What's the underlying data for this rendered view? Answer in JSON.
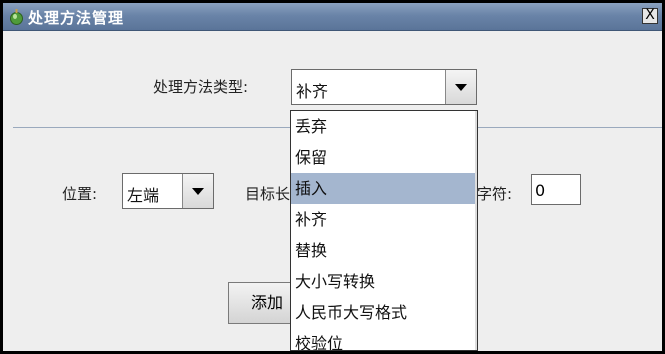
{
  "window": {
    "title": "处理方法管理",
    "close_glyph": "X"
  },
  "method_type": {
    "label": "处理方法类型:",
    "value": "补齐"
  },
  "position": {
    "label": "位置:",
    "value": "左端"
  },
  "target_length": {
    "label": "目标长"
  },
  "fill_char": {
    "label": "字符:",
    "value": "0"
  },
  "add_button": {
    "label": "添加"
  },
  "dropdown": {
    "options": [
      "丢弃",
      "保留",
      "插入",
      "补齐",
      "替换",
      "大小写转换",
      "人民币大写格式",
      "校验位"
    ],
    "highlighted": "插入"
  },
  "colors": {
    "titlebar": "#6a84a8",
    "highlight": "#a4b6cf",
    "window_bg": "#eeeeee"
  }
}
